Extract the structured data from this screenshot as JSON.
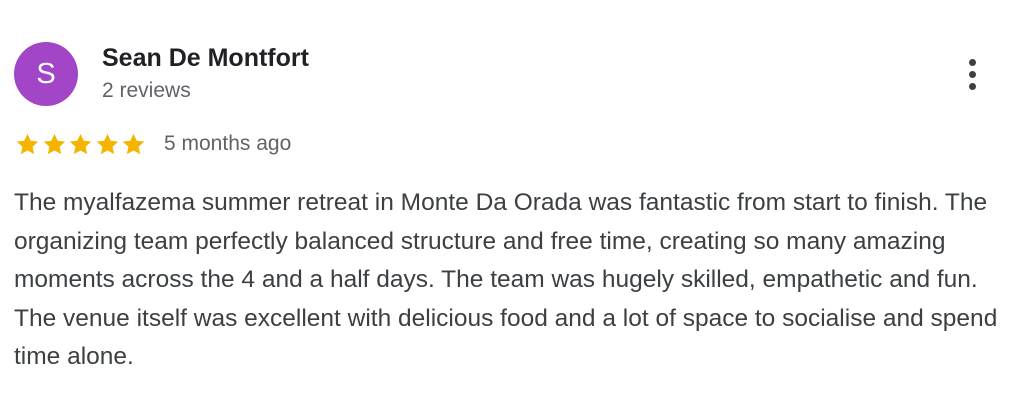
{
  "reviewer": {
    "initial": "S",
    "name": "Sean De Montfort",
    "review_count": "2 reviews",
    "avatar_color": "#a245c7"
  },
  "more_options": {
    "icon": "more-vertical-icon"
  },
  "rating": {
    "stars": 5,
    "max_stars": 5,
    "star_color": "#f4b400",
    "time_ago": "5 months ago"
  },
  "review": {
    "text": "The myalfazema summer retreat in Monte Da Orada was fantastic from start to finish. The organizing team perfectly balanced structure and free time, creating so many amazing moments across the 4 and a half days. The team was hugely skilled, empathetic and fun. The venue itself was excellent with delicious food and a lot of space to socialise and spend time alone."
  }
}
